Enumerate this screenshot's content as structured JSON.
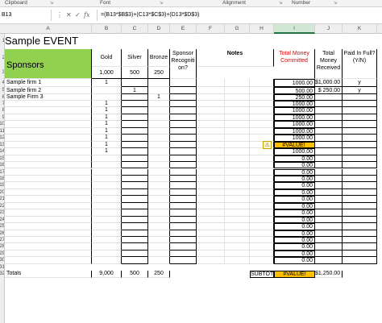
{
  "ribbon": {
    "groups": [
      "Clipboard",
      "Font",
      "Alignment",
      "Number"
    ]
  },
  "formula_bar": {
    "name_box": "B13",
    "cancel_icon": "✕",
    "enter_icon": "✓",
    "fx_icon": "fx",
    "formula": "=(B13*$B$3)+(C13*$C$3)+(D13*$D$3)"
  },
  "columns": [
    "A",
    "B",
    "C",
    "D",
    "E",
    "F",
    "G",
    "H",
    "I",
    "J",
    "K"
  ],
  "selected_column": "I",
  "row_numbers": [
    "1",
    "2",
    "3",
    "4",
    "5",
    "6",
    "7",
    "8",
    "9",
    "10",
    "11",
    "12",
    "13",
    "14",
    "15",
    "16",
    "17",
    "18",
    "19",
    "20",
    "21",
    "22",
    "23",
    "24",
    "25",
    "26",
    "27",
    "28",
    "29",
    "30",
    "31",
    "32"
  ],
  "sheet": {
    "title": "Sample EVENT",
    "sponsors_header": "Sponsors",
    "headers": {
      "gold": "Gold",
      "silver": "Silver",
      "bronze": "Bronze",
      "recognition": "Sponsor Recogniti on?",
      "notes": "Notes",
      "committed": "Total Money Committed",
      "received": "Total Money Received",
      "paid": "Paid In Full? (Y/N)"
    },
    "level_values": {
      "gold": "1,000",
      "silver": "500",
      "bronze": "250"
    },
    "rows": [
      {
        "name": "Sample firm 1",
        "gold": "1",
        "silver": "",
        "bronze": "",
        "committed": "1000.00",
        "received": "$1,000.00",
        "paid": "y"
      },
      {
        "name": "Sample firm 2",
        "gold": "",
        "silver": "1",
        "bronze": "",
        "committed": "500.00",
        "received": "$    250.00",
        "paid": "y"
      },
      {
        "name": "Sample Firm 3",
        "gold": "",
        "silver": "",
        "bronze": "1",
        "committed": "250.00",
        "received": "",
        "paid": ""
      },
      {
        "name": "",
        "gold": "1",
        "silver": "",
        "bronze": "",
        "committed": "1000.00",
        "received": "",
        "paid": ""
      },
      {
        "name": "",
        "gold": "1",
        "silver": "",
        "bronze": "",
        "committed": "1000.00",
        "received": "",
        "paid": ""
      },
      {
        "name": "",
        "gold": "1",
        "silver": "",
        "bronze": "",
        "committed": "1000.00",
        "received": "",
        "paid": ""
      },
      {
        "name": "",
        "gold": "1",
        "silver": "",
        "bronze": "",
        "committed": "1000.00",
        "received": "",
        "paid": ""
      },
      {
        "name": "",
        "gold": "1",
        "silver": "",
        "bronze": "",
        "committed": "1000.00",
        "received": "",
        "paid": ""
      },
      {
        "name": "",
        "gold": "1",
        "silver": "",
        "bronze": "",
        "committed": "1000.00",
        "received": "",
        "paid": ""
      },
      {
        "name": "",
        "gold": "1",
        "silver": "",
        "bronze": "",
        "committed": "#VALUE!",
        "received": "",
        "paid": ""
      },
      {
        "name": "",
        "gold": "1",
        "silver": "",
        "bronze": "",
        "committed": "1000.00",
        "received": "",
        "paid": ""
      },
      {
        "name": "",
        "gold": "",
        "silver": "",
        "bronze": "",
        "committed": "0.00",
        "received": "",
        "paid": ""
      },
      {
        "name": "",
        "gold": "",
        "silver": "",
        "bronze": "",
        "committed": "0.00",
        "received": "",
        "paid": ""
      },
      {
        "name": "",
        "gold": "",
        "silver": "",
        "bronze": "",
        "committed": "0.00",
        "received": "",
        "paid": ""
      },
      {
        "name": "",
        "gold": "",
        "silver": "",
        "bronze": "",
        "committed": "0.00",
        "received": "",
        "paid": ""
      },
      {
        "name": "",
        "gold": "",
        "silver": "",
        "bronze": "",
        "committed": "0.00",
        "received": "",
        "paid": ""
      },
      {
        "name": "",
        "gold": "",
        "silver": "",
        "bronze": "",
        "committed": "0.00",
        "received": "",
        "paid": ""
      },
      {
        "name": "",
        "gold": "",
        "silver": "",
        "bronze": "",
        "committed": "0.00",
        "received": "",
        "paid": ""
      },
      {
        "name": "",
        "gold": "",
        "silver": "",
        "bronze": "",
        "committed": "0.00",
        "received": "",
        "paid": ""
      },
      {
        "name": "",
        "gold": "",
        "silver": "",
        "bronze": "",
        "committed": "0.00",
        "received": "",
        "paid": ""
      },
      {
        "name": "",
        "gold": "",
        "silver": "",
        "bronze": "",
        "committed": "0.00",
        "received": "",
        "paid": ""
      },
      {
        "name": "",
        "gold": "",
        "silver": "",
        "bronze": "",
        "committed": "0.00",
        "received": "",
        "paid": ""
      },
      {
        "name": "",
        "gold": "",
        "silver": "",
        "bronze": "",
        "committed": "0.00",
        "received": "",
        "paid": ""
      },
      {
        "name": "",
        "gold": "",
        "silver": "",
        "bronze": "",
        "committed": "0.00",
        "received": "",
        "paid": ""
      },
      {
        "name": "",
        "gold": "",
        "silver": "",
        "bronze": "",
        "committed": "0.00",
        "received": "",
        "paid": ""
      },
      {
        "name": "",
        "gold": "",
        "silver": "",
        "bronze": "",
        "committed": "0.00",
        "received": "",
        "paid": ""
      },
      {
        "name": "",
        "gold": "",
        "silver": "",
        "bronze": "",
        "committed": "0.00",
        "received": "",
        "paid": ""
      }
    ],
    "totals": {
      "label": "Totals",
      "gold": "9,000",
      "silver": "500",
      "bronze": "250",
      "subtotal_label": "SUBTOTAL",
      "committed": "#VALUE!",
      "received": "$1,250.00"
    },
    "warning_icon": "⚠",
    "colors": {
      "header_green": "#92d050",
      "selected_cell": "#ffc000",
      "red_text": "#e00000"
    }
  }
}
